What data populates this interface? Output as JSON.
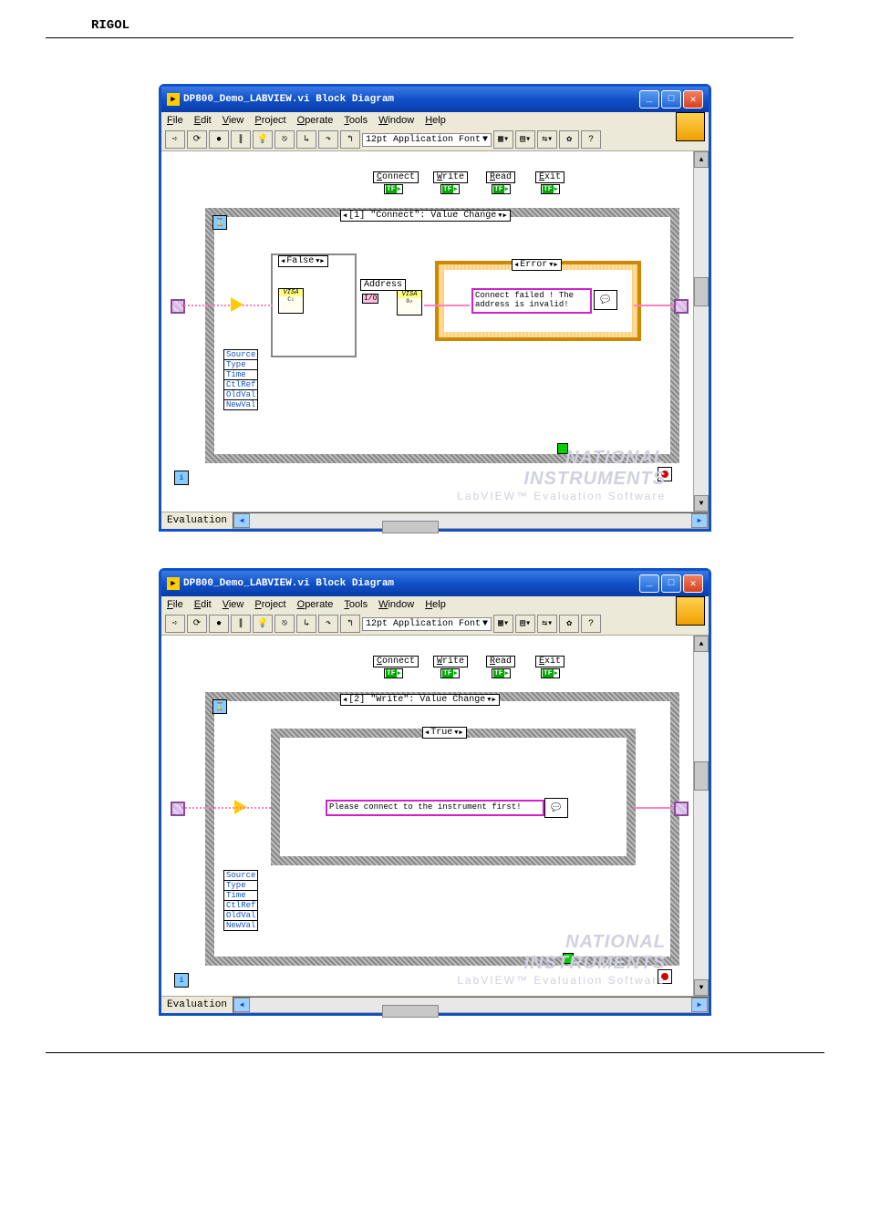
{
  "brand": "RIGOL",
  "window": {
    "title": "DP800_Demo_LABVIEW.vi Block Diagram",
    "menu": [
      "File",
      "Edit",
      "View",
      "Project",
      "Operate",
      "Tools",
      "Window",
      "Help"
    ],
    "font": "12pt Application Font"
  },
  "statusbar": {
    "eval": "Evaluation"
  },
  "watermark": {
    "line1": "NATIONAL",
    "line2": "INSTRUMENTS",
    "line3": "LabVIEW™ Evaluation Software"
  },
  "diagram": {
    "buttons": [
      {
        "label": "Connect",
        "u": "C"
      },
      {
        "label": "Write",
        "u": "W"
      },
      {
        "label": "Read",
        "u": "R"
      },
      {
        "label": "Exit",
        "u": "E"
      }
    ],
    "cluster": [
      "Source",
      "Type",
      "Time",
      "CtlRef",
      "OldVal",
      "NewVal"
    ]
  },
  "screen1": {
    "event_selector": "[1] \"Connect\": Value Change",
    "case_selector": "False",
    "error_selector": "Error",
    "address_label": "Address",
    "io_label": "I/O",
    "msg": "Connect failed ! The address is invalid!"
  },
  "screen2": {
    "event_selector": "[2] \"Write\": Value Change",
    "case_selector": "True",
    "msg": "Please connect to the instrument first!"
  }
}
